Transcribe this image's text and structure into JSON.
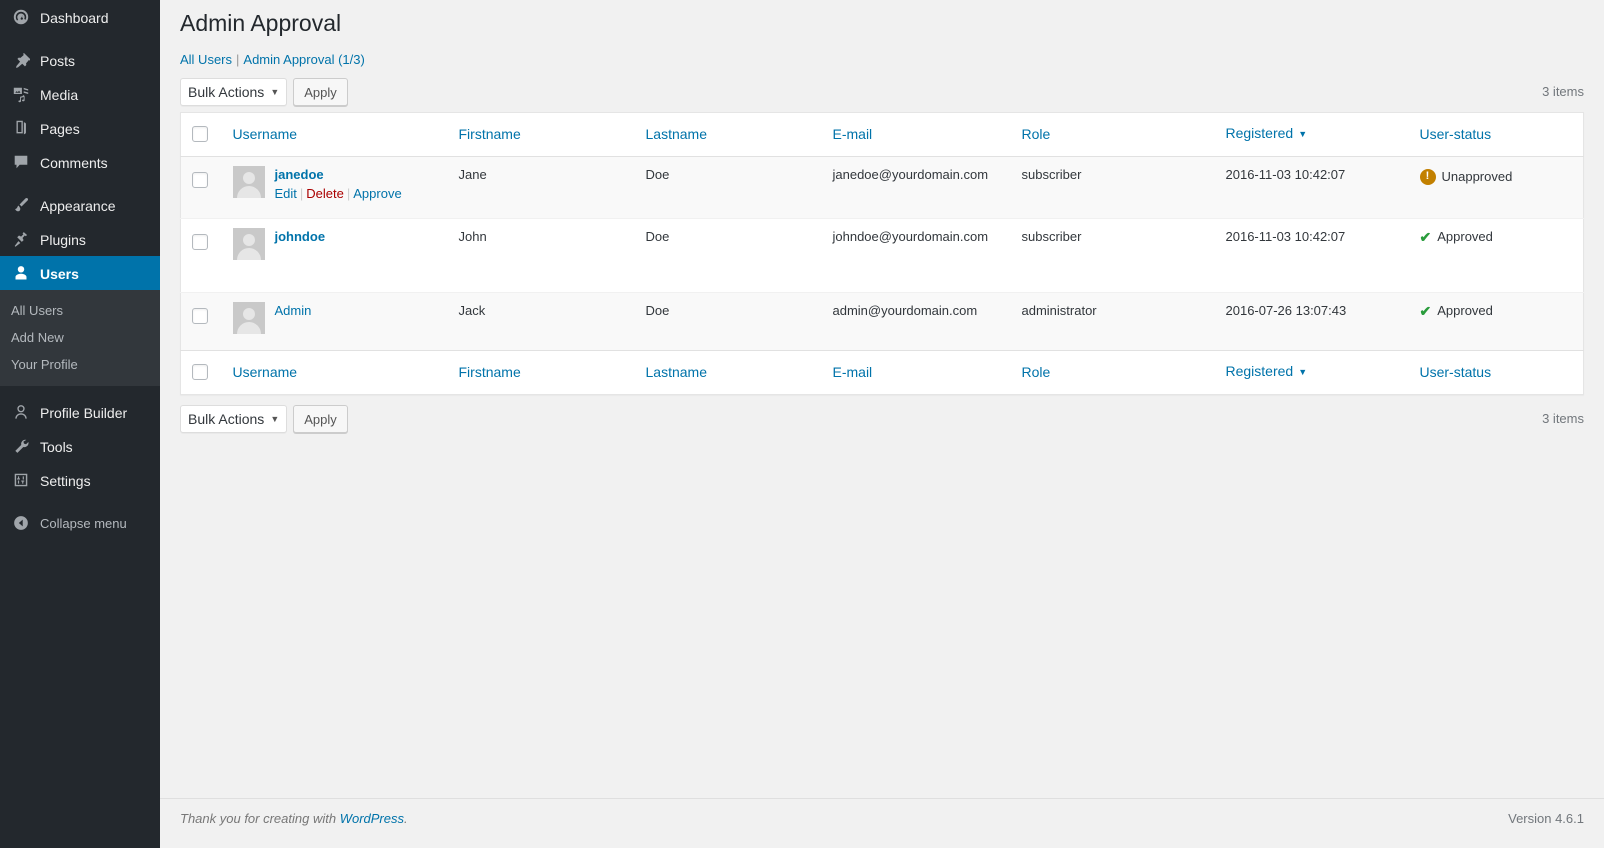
{
  "sidebar": {
    "items": [
      {
        "label": "Dashboard",
        "icon": "dashboard-icon",
        "name": "dashboard"
      },
      {
        "label": "Posts",
        "icon": "pin-icon",
        "name": "posts"
      },
      {
        "label": "Media",
        "icon": "media-icon",
        "name": "media"
      },
      {
        "label": "Pages",
        "icon": "pages-icon",
        "name": "pages"
      },
      {
        "label": "Comments",
        "icon": "comments-icon",
        "name": "comments"
      },
      {
        "label": "Appearance",
        "icon": "brush-icon",
        "name": "appearance"
      },
      {
        "label": "Plugins",
        "icon": "plugin-icon",
        "name": "plugins"
      },
      {
        "label": "Users",
        "icon": "user-icon",
        "name": "users",
        "current": true
      },
      {
        "label": "Profile Builder",
        "icon": "profile-builder-icon",
        "name": "profile-builder"
      },
      {
        "label": "Tools",
        "icon": "wrench-icon",
        "name": "tools"
      },
      {
        "label": "Settings",
        "icon": "settings-icon",
        "name": "settings"
      },
      {
        "label": "Collapse menu",
        "icon": "collapse-icon",
        "name": "collapse-menu"
      }
    ],
    "submenu": [
      {
        "label": "All Users",
        "name": "all-users"
      },
      {
        "label": "Add New",
        "name": "add-new"
      },
      {
        "label": "Your Profile",
        "name": "your-profile"
      }
    ]
  },
  "header": {
    "title": "Admin Approval",
    "breadcrumb": {
      "all_users": "All Users",
      "separator": "|",
      "current": "Admin Approval",
      "count": "(1/3)"
    }
  },
  "toolbar": {
    "bulk_actions_label": "Bulk Actions",
    "bulk_actions_caret": "▼",
    "apply_label": "Apply",
    "items_count_top": "3 items",
    "items_count_bottom": "3 items"
  },
  "table": {
    "columns": [
      {
        "label": "Username",
        "name": "username"
      },
      {
        "label": "Firstname",
        "name": "firstname"
      },
      {
        "label": "Lastname",
        "name": "lastname"
      },
      {
        "label": "E-mail",
        "name": "email"
      },
      {
        "label": "Role",
        "name": "role"
      },
      {
        "label": "Registered",
        "name": "registered",
        "sorted": true,
        "caret": "▼"
      },
      {
        "label": "User-status",
        "name": "user-status"
      }
    ],
    "rows": [
      {
        "username": "janedoe",
        "firstname": "Jane",
        "lastname": "Doe",
        "email": "janedoe@yourdomain.com",
        "role": "subscriber",
        "registered": "2016-11-03 10:42:07",
        "status": "Unapproved",
        "status_type": "unapproved",
        "status_icon": "warning-icon",
        "actions": {
          "edit": "Edit",
          "delete": "Delete",
          "approve": "Approve",
          "sep": "|"
        }
      },
      {
        "username": "johndoe",
        "firstname": "John",
        "lastname": "Doe",
        "email": "johndoe@yourdomain.com",
        "role": "subscriber",
        "registered": "2016-11-03 10:42:07",
        "status": "Approved",
        "status_type": "approved",
        "status_icon": "check-icon",
        "check_glyph": "✔"
      },
      {
        "username": "Admin",
        "firstname": "Jack",
        "lastname": "Doe",
        "email": "admin@yourdomain.com",
        "role": "administrator",
        "registered": "2016-07-26 13:07:43",
        "status": "Approved",
        "status_type": "approved",
        "status_icon": "check-icon",
        "check_glyph": "✔"
      }
    ]
  },
  "footer": {
    "thank_you_prefix": "Thank you for creating with ",
    "wordpress_link": "WordPress",
    "thank_you_suffix": ".",
    "version": "Version 4.6.1"
  },
  "colors": {
    "accent": "#0073aa",
    "sidebar_bg": "#23282d",
    "submenu_bg": "#32373c",
    "unapproved": "#c28000",
    "approved": "#2a9c3c",
    "delete": "#a00"
  }
}
